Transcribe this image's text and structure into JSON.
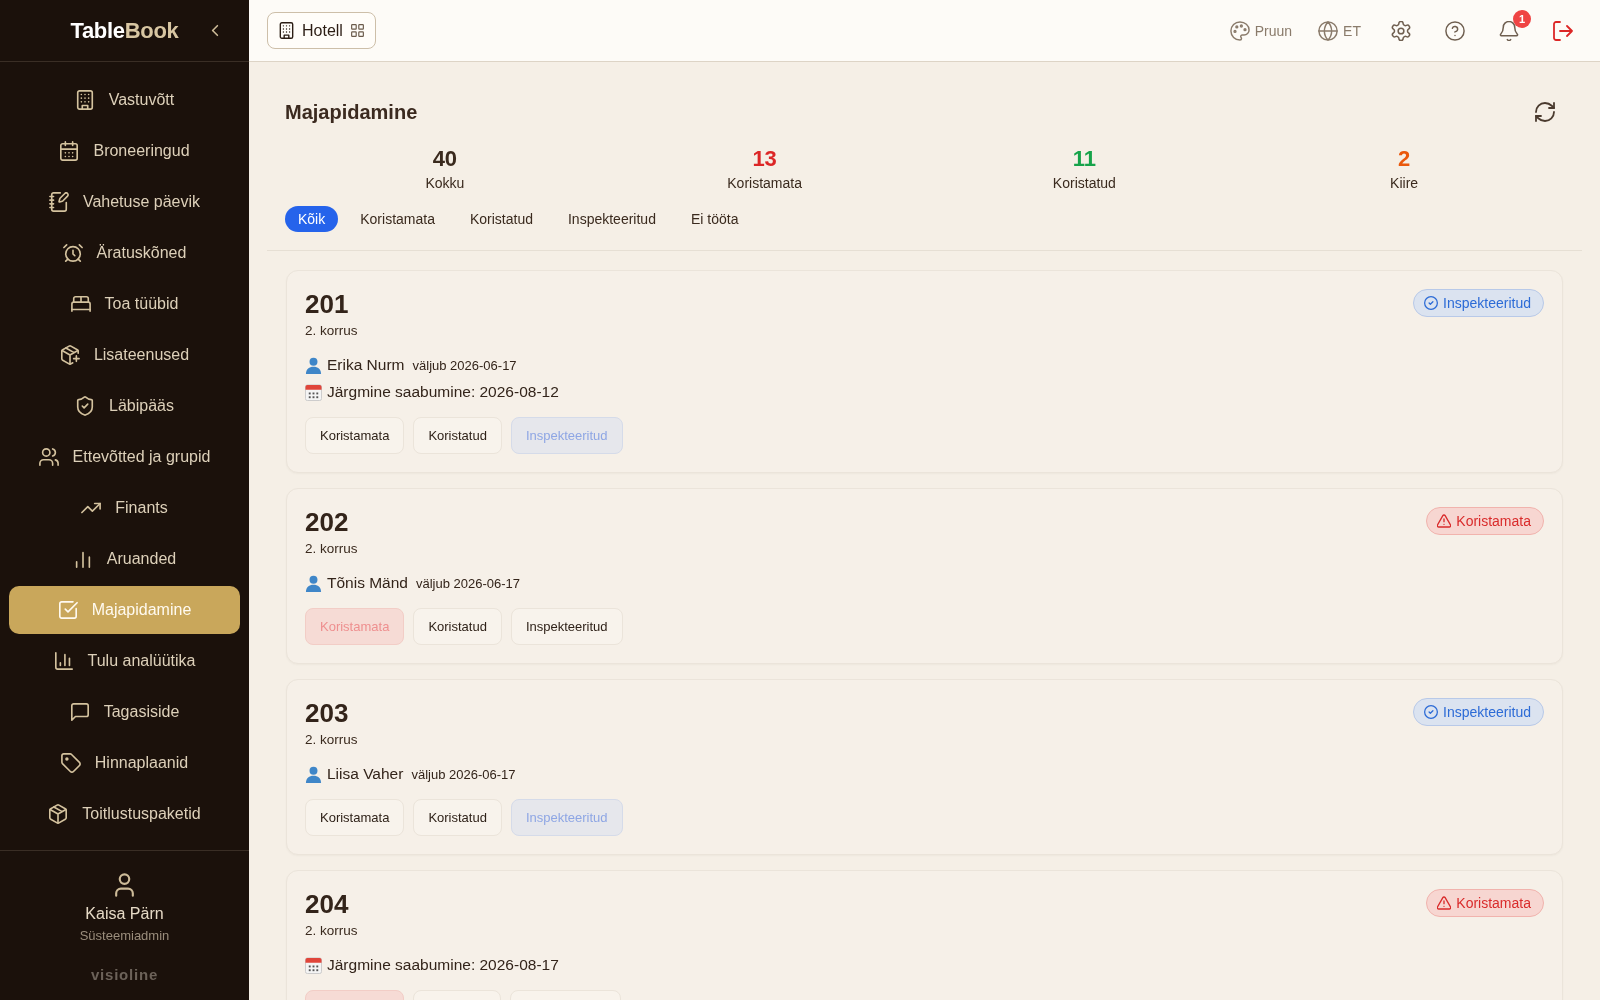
{
  "sidebar": {
    "logo": [
      "Table",
      "Book"
    ],
    "items": [
      {
        "label": "Vastuvõtt",
        "selected": false
      },
      {
        "label": "Broneeringud",
        "selected": false
      },
      {
        "label": "Vahetuse päevik",
        "selected": false
      },
      {
        "label": "Äratuskõned",
        "selected": false
      },
      {
        "label": "Toa tüübid",
        "selected": false
      },
      {
        "label": "Lisateenused",
        "selected": false
      },
      {
        "label": "Läbipääs",
        "selected": false
      },
      {
        "label": "Ettevõtted ja grupid",
        "selected": false
      },
      {
        "label": "Finants",
        "selected": false
      },
      {
        "label": "Aruanded",
        "selected": false
      },
      {
        "label": "Majapidamine",
        "selected": true
      },
      {
        "label": "Tulu analüütika",
        "selected": false
      },
      {
        "label": "Tagasiside",
        "selected": false
      },
      {
        "label": "Hinnaplaanid",
        "selected": false
      },
      {
        "label": "Toitlustuspaketid",
        "selected": false
      }
    ],
    "user": {
      "name": "Kaisa Pärn",
      "role": "Süsteemiadmin"
    },
    "brand": "visioline"
  },
  "header": {
    "property": "Hotell",
    "theme": "Pruun",
    "language": "ET",
    "notification_count": "1"
  },
  "housekeeping": {
    "title": "Majapidamine",
    "stats": [
      {
        "value": "40",
        "label": "Kokku",
        "color": "#3a2a1e"
      },
      {
        "value": "13",
        "label": "Koristamata",
        "color": "#dc2626"
      },
      {
        "value": "11",
        "label": "Koristatud",
        "color": "#16a34a"
      },
      {
        "value": "2",
        "label": "Kiire",
        "color": "#ea580c"
      }
    ],
    "filters": [
      {
        "label": "Kõik",
        "selected": true
      },
      {
        "label": "Koristamata",
        "selected": false
      },
      {
        "label": "Koristatud",
        "selected": false
      },
      {
        "label": "Inspekteeritud",
        "selected": false
      },
      {
        "label": "Ei tööta",
        "selected": false
      }
    ]
  },
  "rooms": [
    {
      "number": "201",
      "floor": "2. korrus",
      "badge": {
        "kind": "inspected",
        "label": "Inspekteeritud"
      },
      "guest": {
        "name": "Erika Nurm",
        "checkout": "väljub 2026-06-17"
      },
      "next_arrival": "Järgmine saabumine: 2026-08-12",
      "buttons": [
        {
          "label": "Koristamata",
          "selected": false
        },
        {
          "label": "Koristatud",
          "selected": false
        },
        {
          "label": "Inspekteeritud",
          "selected": true
        }
      ]
    },
    {
      "number": "202",
      "floor": "2. korrus",
      "badge": {
        "kind": "dirty",
        "label": "Koristamata"
      },
      "guest": {
        "name": "Tõnis Mänd",
        "checkout": "väljub 2026-06-17"
      },
      "buttons": [
        {
          "label": "Koristamata",
          "selected": true
        },
        {
          "label": "Koristatud",
          "selected": false
        },
        {
          "label": "Inspekteeritud",
          "selected": false
        }
      ]
    },
    {
      "number": "203",
      "floor": "2. korrus",
      "badge": {
        "kind": "inspected",
        "label": "Inspekteeritud"
      },
      "guest": {
        "name": "Liisa Vaher",
        "checkout": "väljub 2026-06-17"
      },
      "buttons": [
        {
          "label": "Koristamata",
          "selected": false
        },
        {
          "label": "Koristatud",
          "selected": false
        },
        {
          "label": "Inspekteeritud",
          "selected": true
        }
      ]
    },
    {
      "number": "204",
      "floor": "2. korrus",
      "badge": {
        "kind": "dirty",
        "label": "Koristamata"
      },
      "next_arrival": "Järgmine saabumine: 2026-08-17",
      "buttons": [
        {
          "selected": true
        },
        {
          "selected": false
        },
        {
          "selected": false
        }
      ]
    }
  ]
}
